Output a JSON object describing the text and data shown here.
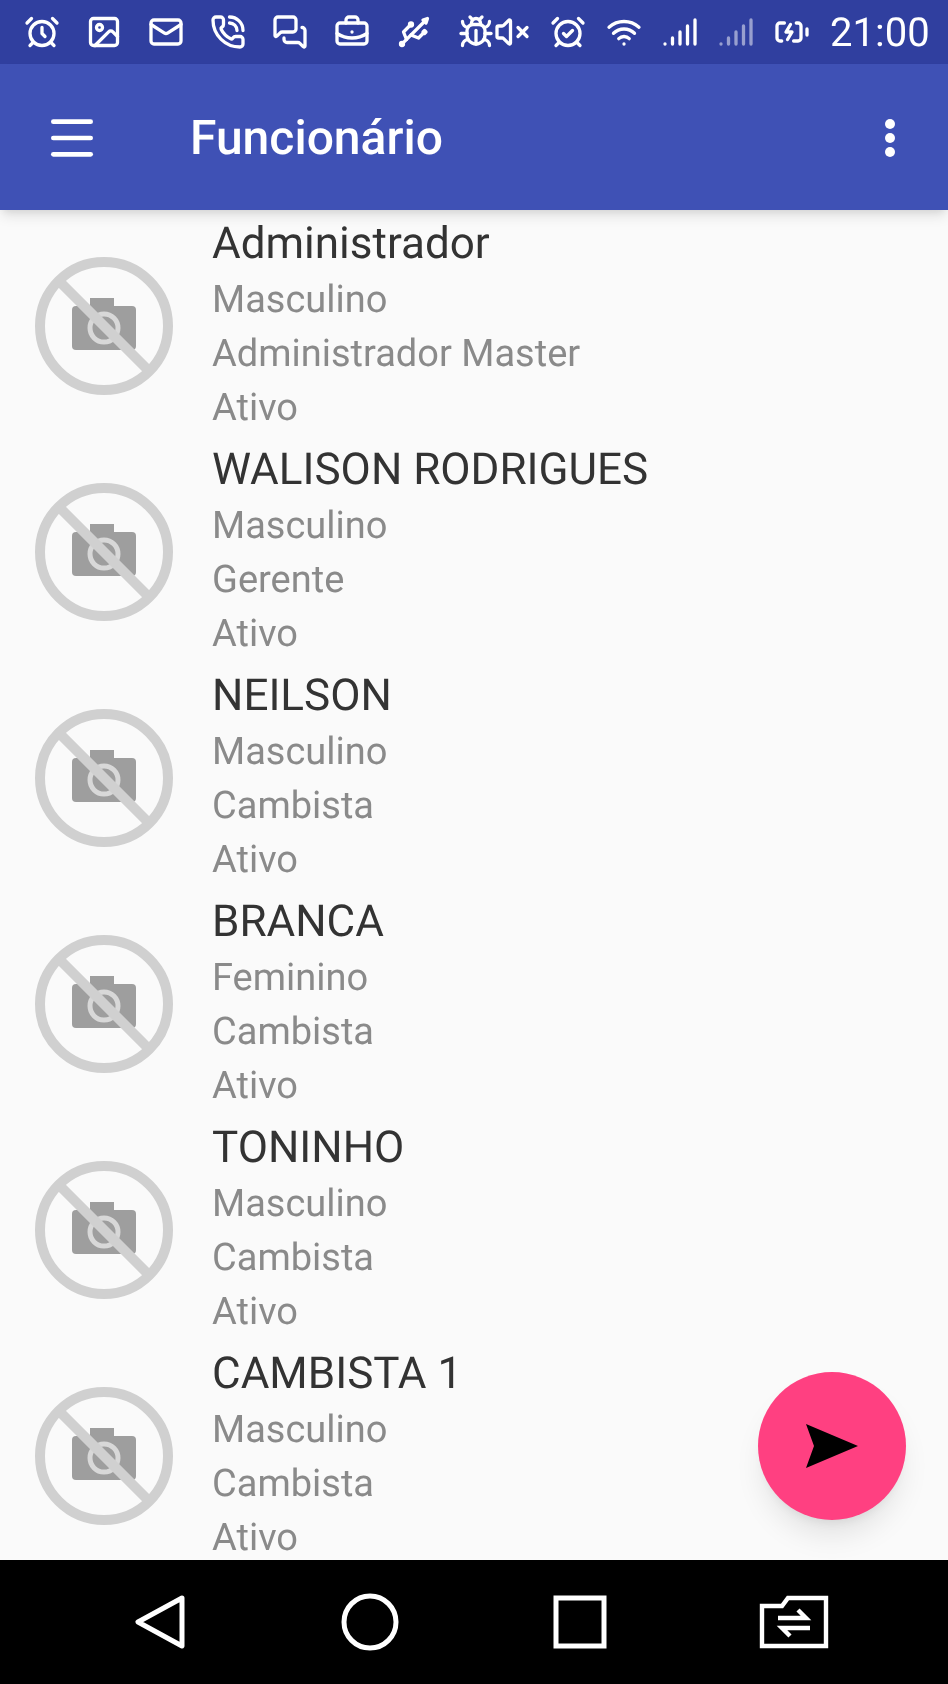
{
  "status_bar": {
    "time": "21:00"
  },
  "app_bar": {
    "title": "Funcionário"
  },
  "employees": [
    {
      "name": "Administrador",
      "gender": "Masculino",
      "role": "Administrador Master",
      "status": "Ativo"
    },
    {
      "name": "WALISON RODRIGUES",
      "gender": "Masculino",
      "role": "Gerente",
      "status": "Ativo"
    },
    {
      "name": "NEILSON",
      "gender": "Masculino",
      "role": "Cambista",
      "status": "Ativo"
    },
    {
      "name": "BRANCA",
      "gender": "Feminino",
      "role": "Cambista",
      "status": "Ativo"
    },
    {
      "name": "TONINHO",
      "gender": "Masculino",
      "role": "Cambista",
      "status": "Ativo"
    },
    {
      "name": "CAMBISTA 1",
      "gender": "Masculino",
      "role": "Cambista",
      "status": "Ativo"
    }
  ]
}
